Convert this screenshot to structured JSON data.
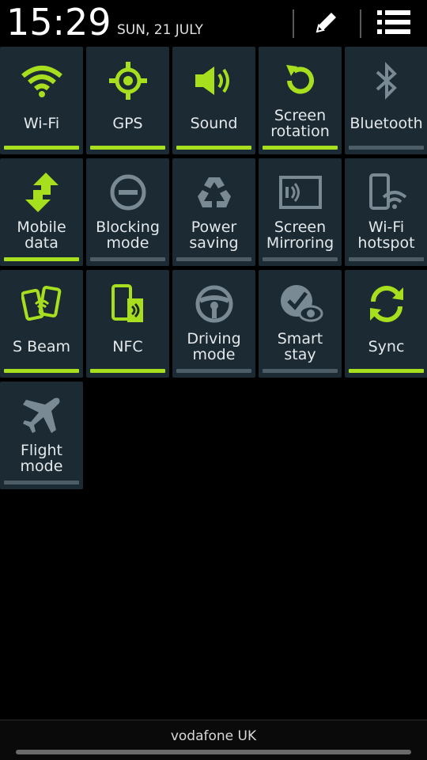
{
  "status": {
    "time": "15:29",
    "date": "SUN, 21 JULY"
  },
  "header_icons": {
    "edit": "pencil-icon",
    "settings": "list-menu-icon"
  },
  "colors": {
    "accent_green": "#a7df1f",
    "tile_bg": "#1b2a33",
    "icon_off": "#7a8a94",
    "bar_off": "#4d5d67"
  },
  "tiles": [
    {
      "label": "Wi-Fi",
      "on": true,
      "icon": "wifi-icon"
    },
    {
      "label": "GPS",
      "on": true,
      "icon": "gps-icon"
    },
    {
      "label": "Sound",
      "on": true,
      "icon": "sound-icon"
    },
    {
      "label": "Screen\nrotation",
      "on": true,
      "icon": "screen-rotation-icon"
    },
    {
      "label": "Bluetooth",
      "on": false,
      "icon": "bluetooth-icon"
    },
    {
      "label": "Mobile\ndata",
      "on": true,
      "icon": "mobile-data-icon"
    },
    {
      "label": "Blocking\nmode",
      "on": false,
      "icon": "blocking-mode-icon"
    },
    {
      "label": "Power\nsaving",
      "on": false,
      "icon": "power-saving-icon"
    },
    {
      "label": "Screen\nMirroring",
      "on": false,
      "icon": "screen-mirroring-icon"
    },
    {
      "label": "Wi-Fi\nhotspot",
      "on": false,
      "icon": "wifi-hotspot-icon"
    },
    {
      "label": "S Beam",
      "on": true,
      "icon": "s-beam-icon"
    },
    {
      "label": "NFC",
      "on": true,
      "icon": "nfc-icon"
    },
    {
      "label": "Driving\nmode",
      "on": false,
      "icon": "driving-mode-icon"
    },
    {
      "label": "Smart\nstay",
      "on": false,
      "icon": "smart-stay-icon"
    },
    {
      "label": "Sync",
      "on": true,
      "icon": "sync-icon"
    },
    {
      "label": "Flight\nmode",
      "on": false,
      "icon": "flight-mode-icon"
    }
  ],
  "footer": {
    "carrier": "vodafone UK"
  }
}
